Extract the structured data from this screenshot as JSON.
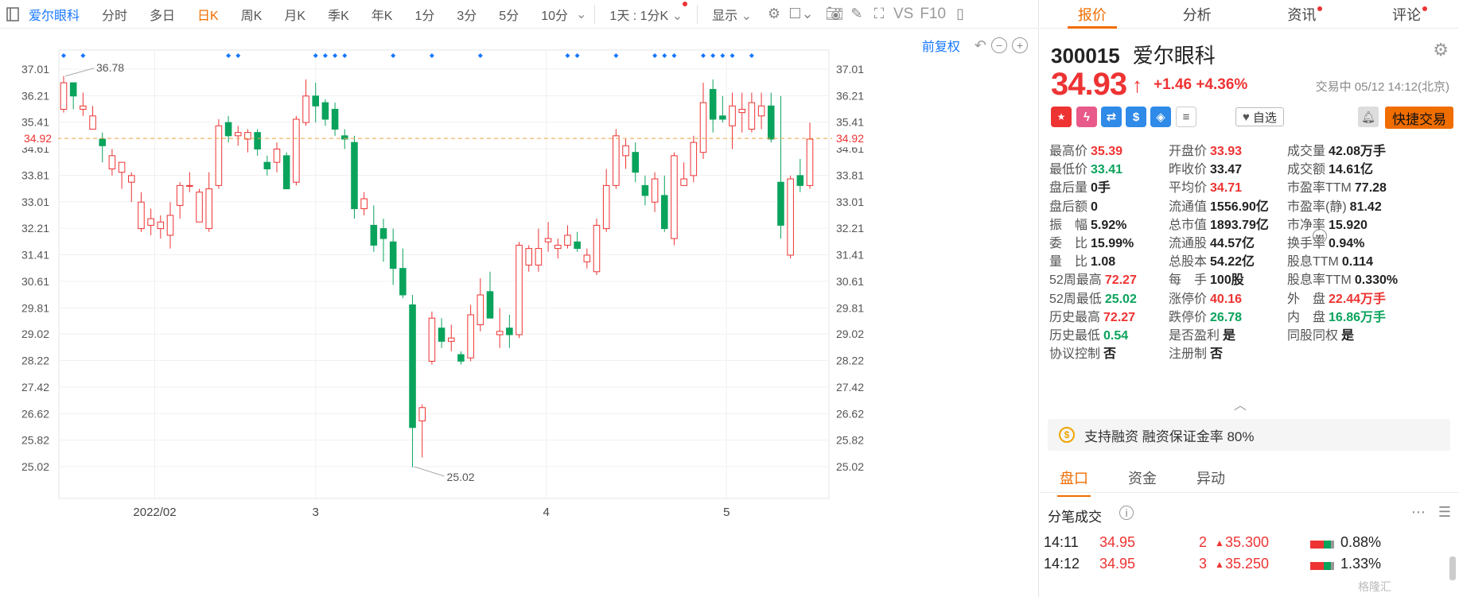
{
  "toolbar": {
    "menu_icon": "panel-icon",
    "stock_name": "爱尔眼科",
    "tabs": [
      "分时",
      "多日",
      "日K",
      "周K",
      "月K",
      "季K",
      "年K",
      "1分",
      "3分",
      "5分",
      "10分"
    ],
    "active_tab": "日K",
    "period_select": "1天 : 1分K",
    "display_label": "显示",
    "vs_label": "VS",
    "f10_label": "F10"
  },
  "chart_controls": {
    "adjust_label": "前复权"
  },
  "chart_data": {
    "type": "candlestick",
    "y_ticks": [
      "37.01",
      "36.21",
      "35.41",
      "34.61",
      "33.81",
      "33.01",
      "32.21",
      "31.41",
      "30.61",
      "29.81",
      "29.02",
      "28.22",
      "27.42",
      "26.62",
      "25.82",
      "25.02"
    ],
    "x_ticks": [
      "2022/02",
      "3",
      "4",
      "5"
    ],
    "current_price_label": "34.92",
    "current_price": 34.92,
    "max_label": "36.78",
    "min_label": "25.02",
    "ylim": [
      25.02,
      37.01
    ],
    "up_color": "#e33",
    "down_color": "#0aa35c",
    "candles": [
      [
        35.8,
        36.8,
        35.7,
        36.6
      ],
      [
        36.6,
        36.3,
        35.8,
        36.2
      ],
      [
        35.8,
        36.3,
        35.6,
        35.9
      ],
      [
        35.2,
        35.9,
        35.3,
        35.6
      ],
      [
        34.9,
        35.1,
        34.2,
        34.7
      ],
      [
        34.0,
        34.6,
        33.8,
        34.4
      ],
      [
        33.9,
        34.2,
        33.4,
        34.2
      ],
      [
        33.6,
        33.9,
        33.0,
        33.8
      ],
      [
        32.2,
        33.3,
        32.1,
        33.0
      ],
      [
        32.3,
        32.8,
        32.0,
        32.5
      ],
      [
        32.2,
        32.6,
        31.9,
        32.4
      ],
      [
        32.0,
        33.0,
        31.6,
        32.6
      ],
      [
        32.9,
        33.6,
        32.5,
        33.5
      ],
      [
        33.5,
        33.9,
        33.3,
        33.5
      ],
      [
        32.4,
        33.4,
        32.4,
        33.3
      ],
      [
        32.2,
        33.9,
        32.1,
        33.4
      ],
      [
        33.5,
        35.5,
        33.4,
        35.3
      ],
      [
        35.4,
        35.6,
        34.8,
        35.0
      ],
      [
        35.0,
        35.3,
        34.7,
        35.1
      ],
      [
        34.9,
        35.2,
        34.5,
        35.1
      ],
      [
        35.1,
        35.2,
        34.4,
        34.6
      ],
      [
        34.2,
        34.4,
        33.8,
        34.0
      ],
      [
        34.2,
        34.8,
        33.9,
        34.6
      ],
      [
        34.4,
        34.5,
        33.4,
        33.4
      ],
      [
        33.6,
        35.6,
        33.5,
        35.5
      ],
      [
        35.4,
        36.7,
        35.3,
        36.2
      ],
      [
        36.2,
        36.6,
        35.4,
        35.9
      ],
      [
        36.0,
        36.1,
        35.3,
        35.5
      ],
      [
        35.8,
        36.0,
        35.0,
        35.2
      ],
      [
        35.0,
        35.2,
        34.6,
        34.9
      ],
      [
        34.8,
        35.0,
        32.5,
        32.8
      ],
      [
        32.8,
        33.3,
        32.6,
        33.1
      ],
      [
        32.3,
        32.9,
        31.5,
        31.7
      ],
      [
        32.2,
        32.5,
        31.2,
        31.9
      ],
      [
        31.8,
        32.2,
        30.5,
        31.0
      ],
      [
        31.0,
        31.6,
        30.1,
        30.2
      ],
      [
        29.9,
        30.2,
        25.0,
        26.2
      ],
      [
        26.4,
        26.9,
        25.3,
        26.8
      ],
      [
        28.2,
        29.7,
        28.1,
        29.5
      ],
      [
        29.2,
        29.5,
        28.6,
        28.8
      ],
      [
        28.8,
        29.3,
        28.5,
        28.9
      ],
      [
        28.4,
        28.5,
        28.1,
        28.2
      ],
      [
        28.3,
        29.9,
        28.2,
        29.6
      ],
      [
        29.3,
        30.7,
        29.1,
        30.2
      ],
      [
        30.3,
        30.9,
        29.6,
        29.5
      ],
      [
        29.0,
        29.8,
        28.6,
        29.1
      ],
      [
        29.2,
        29.6,
        28.6,
        29.0
      ],
      [
        29.0,
        31.8,
        28.9,
        31.7
      ],
      [
        31.1,
        31.7,
        30.9,
        31.6
      ],
      [
        31.1,
        32.2,
        30.9,
        31.6
      ],
      [
        31.8,
        32.4,
        31.5,
        31.9
      ],
      [
        31.6,
        31.9,
        31.3,
        31.7
      ],
      [
        31.7,
        32.3,
        31.6,
        32.0
      ],
      [
        31.8,
        32.1,
        31.5,
        31.6
      ],
      [
        31.2,
        31.6,
        31.0,
        31.4
      ],
      [
        30.9,
        32.5,
        30.8,
        32.3
      ],
      [
        32.2,
        34.0,
        32.1,
        33.5
      ],
      [
        33.5,
        35.2,
        33.4,
        35.0
      ],
      [
        34.4,
        34.9,
        34.0,
        34.7
      ],
      [
        34.5,
        34.8,
        33.6,
        33.9
      ],
      [
        33.5,
        33.8,
        32.9,
        33.2
      ],
      [
        33.0,
        33.9,
        32.7,
        33.7
      ],
      [
        33.2,
        33.8,
        32.1,
        32.2
      ],
      [
        31.9,
        34.5,
        31.7,
        34.4
      ],
      [
        33.5,
        34.2,
        33.5,
        33.7
      ],
      [
        33.8,
        35.0,
        33.6,
        34.8
      ],
      [
        34.5,
        36.6,
        34.3,
        36.0
      ],
      [
        36.4,
        36.7,
        35.1,
        35.5
      ],
      [
        35.6,
        36.2,
        35.4,
        35.5
      ],
      [
        35.3,
        36.3,
        34.6,
        35.9
      ],
      [
        35.7,
        36.3,
        35.1,
        35.8
      ],
      [
        35.2,
        36.3,
        35.1,
        36.0
      ],
      [
        35.6,
        36.3,
        35.2,
        35.9
      ],
      [
        35.9,
        36.3,
        34.8,
        34.9
      ],
      [
        33.6,
        36.2,
        31.9,
        32.3
      ],
      [
        31.4,
        33.8,
        31.3,
        33.7
      ],
      [
        33.8,
        34.3,
        33.3,
        33.5
      ],
      [
        33.5,
        35.4,
        33.4,
        34.9
      ]
    ],
    "marker_color": "#1677ff"
  },
  "quote": {
    "code": "300015",
    "name": "爱尔眼科",
    "price": "34.93",
    "arrow": "↑",
    "change": "+1.46",
    "change_pct": "+4.36%",
    "status": "交易中 05/12 14:12(北京)",
    "watch_label": "自选",
    "quick_trade": "快捷交易",
    "margin_text": "支持融资 融资保证金率 80%",
    "expand_icon": "chevron-up-icon"
  },
  "right_tabs": [
    "报价",
    "分析",
    "资讯",
    "评论"
  ],
  "stats": [
    [
      {
        "label": "最高价",
        "value": "35.39",
        "color": "red"
      },
      {
        "label": "开盘价",
        "value": "33.93",
        "color": "red"
      },
      {
        "label": "成交量",
        "value": "42.08万手",
        "color": ""
      }
    ],
    [
      {
        "label": "最低价",
        "value": "33.41",
        "color": "green"
      },
      {
        "label": "昨收价",
        "value": "33.47",
        "color": ""
      },
      {
        "label": "成交额",
        "value": "14.61亿",
        "color": ""
      }
    ],
    [
      {
        "label": "盘后量",
        "value": "0手",
        "color": ""
      },
      {
        "label": "平均价",
        "value": "34.71",
        "color": "red"
      },
      {
        "label": "市盈率TTM",
        "value": "77.28",
        "color": ""
      }
    ],
    [
      {
        "label": "盘后额",
        "value": "0",
        "color": ""
      },
      {
        "label": "流通值",
        "value": "1556.90亿",
        "color": ""
      },
      {
        "label": "市盈率(静)",
        "value": "81.42",
        "color": ""
      }
    ],
    [
      {
        "label": "振　幅",
        "value": "5.92%",
        "color": ""
      },
      {
        "label": "总市值",
        "value": "1893.79亿",
        "color": ""
      },
      {
        "label": "市净率",
        "value": "15.920",
        "color": ""
      }
    ],
    [
      {
        "label": "委　比",
        "value": "15.99%",
        "color": ""
      },
      {
        "label": "流通股",
        "value": "44.57亿",
        "color": ""
      },
      {
        "label": "换手率",
        "value": "0.94%",
        "color": ""
      }
    ],
    [
      {
        "label": "量　比",
        "value": "1.08",
        "color": ""
      },
      {
        "label": "总股本",
        "value": "54.22亿",
        "color": ""
      },
      {
        "label": "股息TTM",
        "value": "0.114",
        "color": ""
      }
    ],
    [
      {
        "label": "52周最高",
        "value": "72.27",
        "color": "red"
      },
      {
        "label": "每　手",
        "value": "100股",
        "color": ""
      },
      {
        "label": "股息率TTM",
        "value": "0.330%",
        "color": ""
      }
    ],
    [
      {
        "label": "52周最低",
        "value": "25.02",
        "color": "green"
      },
      {
        "label": "涨停价",
        "value": "40.16",
        "color": "red"
      },
      {
        "label": "外　盘",
        "value": "22.44万手",
        "color": "red"
      }
    ],
    [
      {
        "label": "历史最高",
        "value": "72.27",
        "color": "red"
      },
      {
        "label": "跌停价",
        "value": "26.78",
        "color": "green"
      },
      {
        "label": "内　盘",
        "value": "16.86万手",
        "color": "green"
      }
    ],
    [
      {
        "label": "历史最低",
        "value": "0.54",
        "color": "green"
      },
      {
        "label": "是否盈利",
        "value": "是",
        "color": ""
      },
      {
        "label": "同股同权",
        "value": "是",
        "color": ""
      }
    ],
    [
      {
        "label": "协议控制",
        "value": "否",
        "color": ""
      },
      {
        "label": "注册制",
        "value": "否",
        "color": ""
      },
      {
        "label": "",
        "value": "",
        "color": ""
      }
    ]
  ],
  "panel_tabs": [
    "盘口",
    "资金",
    "异动"
  ],
  "tick_title": "分笔成交",
  "ticks": [
    {
      "time": "14:11",
      "price": "34.95",
      "vol": "2",
      "arrow": "▲",
      "bprice": "35.300",
      "pct": "0.88%"
    },
    {
      "time": "14:12",
      "price": "34.95",
      "vol": "3",
      "arrow": "▲",
      "bprice": "35.250",
      "pct": "1.33%"
    }
  ],
  "watermark": "格隆汇"
}
